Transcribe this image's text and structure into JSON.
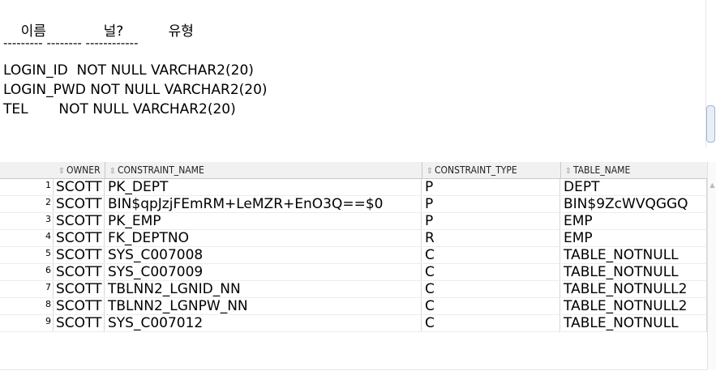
{
  "output": {
    "header": {
      "col1": "이름",
      "col2": "널?",
      "col3": "유형"
    },
    "separator": "--------- -------- ------------",
    "lines": [
      "LOGIN_ID  NOT NULL VARCHAR2(20)",
      "LOGIN_PWD NOT NULL VARCHAR2(20)",
      "TEL       NOT NULL VARCHAR2(20)"
    ]
  },
  "grid": {
    "columns": [
      "OWNER",
      "CONSTRAINT_NAME",
      "CONSTRAINT_TYPE",
      "TABLE_NAME"
    ],
    "sort_icon": "⇳",
    "rows": [
      {
        "n": "1",
        "owner": "SCOTT",
        "constraint_name": "PK_DEPT",
        "constraint_type": "P",
        "table_name": "DEPT"
      },
      {
        "n": "2",
        "owner": "SCOTT",
        "constraint_name": "BIN$qpJzjFEmRM+LeMZR+EnO3Q==$0",
        "constraint_type": "P",
        "table_name": "BIN$9ZcWVQGGQ"
      },
      {
        "n": "3",
        "owner": "SCOTT",
        "constraint_name": "PK_EMP",
        "constraint_type": "P",
        "table_name": "EMP"
      },
      {
        "n": "4",
        "owner": "SCOTT",
        "constraint_name": "FK_DEPTNO",
        "constraint_type": "R",
        "table_name": "EMP"
      },
      {
        "n": "5",
        "owner": "SCOTT",
        "constraint_name": "SYS_C007008",
        "constraint_type": "C",
        "table_name": "TABLE_NOTNULL"
      },
      {
        "n": "6",
        "owner": "SCOTT",
        "constraint_name": "SYS_C007009",
        "constraint_type": "C",
        "table_name": "TABLE_NOTNULL"
      },
      {
        "n": "7",
        "owner": "SCOTT",
        "constraint_name": "TBLNN2_LGNID_NN",
        "constraint_type": "C",
        "table_name": "TABLE_NOTNULL2"
      },
      {
        "n": "8",
        "owner": "SCOTT",
        "constraint_name": "TBLNN2_LGNPW_NN",
        "constraint_type": "C",
        "table_name": "TABLE_NOTNULL2"
      },
      {
        "n": "9",
        "owner": "SCOTT",
        "constraint_name": "SYS_C007012",
        "constraint_type": "C",
        "table_name": "TABLE_NOTNULL"
      }
    ]
  }
}
